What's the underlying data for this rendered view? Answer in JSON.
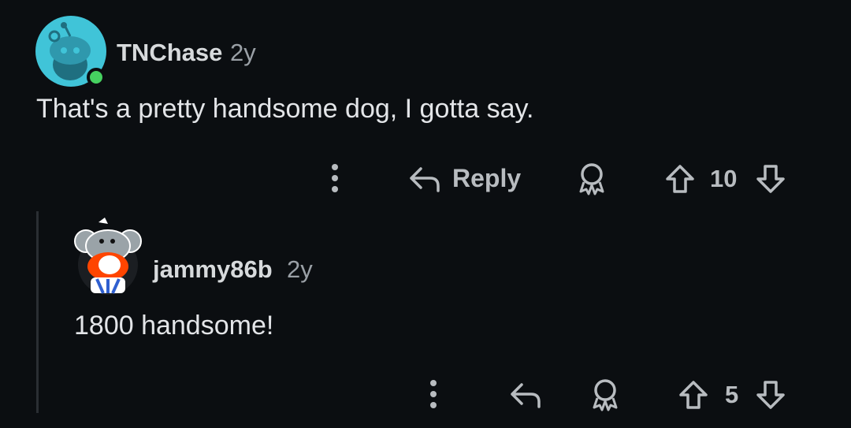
{
  "comments": [
    {
      "username": "TNChase",
      "age": "2y",
      "text": "That's a pretty handsome dog, I gotta say.",
      "actions": {
        "reply_label": "Reply",
        "vote_count": "10"
      },
      "online": true
    },
    {
      "username": "jammy86b",
      "age": "2y",
      "text": "1800 handsome!",
      "actions": {
        "vote_count": "5"
      }
    }
  ],
  "colors": {
    "background": "#0b0e11",
    "avatar_teal": "#40c4d8",
    "online": "#46d160",
    "accent_orange": "#ff4500"
  },
  "icons": [
    "snoo-avatar-icon",
    "more-options-icon",
    "reply-arrow-icon",
    "award-icon",
    "upvote-icon",
    "downvote-icon"
  ]
}
